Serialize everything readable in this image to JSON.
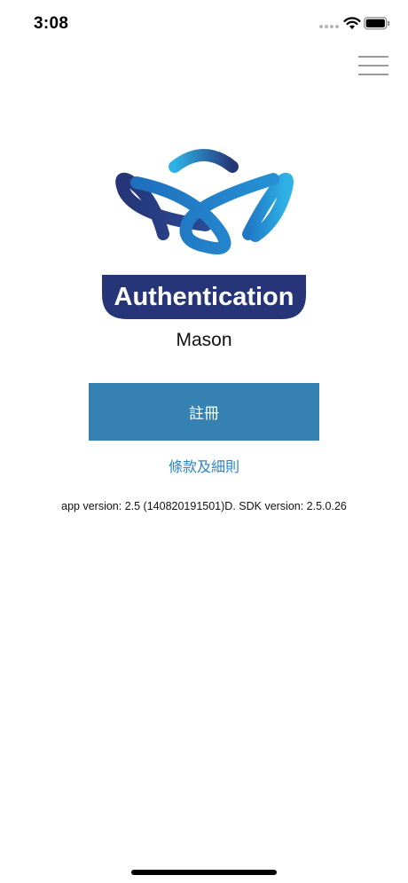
{
  "status_bar": {
    "time": "3:08"
  },
  "menu": {
    "icon": "hamburger-menu-icon"
  },
  "logo": {
    "wordmark": "Authentication",
    "colors": {
      "navy": "#253578",
      "blue": "#1f78c5",
      "light_blue": "#2fb3e6"
    }
  },
  "account": {
    "name": "Mason"
  },
  "actions": {
    "register_label": "註冊",
    "terms_label": "條款及細則"
  },
  "footer": {
    "version_text": "app version: 2.5 (140820191501)D. SDK version: 2.5.0.26"
  },
  "colors": {
    "button": "#3481b2",
    "link": "#2b86c8"
  }
}
